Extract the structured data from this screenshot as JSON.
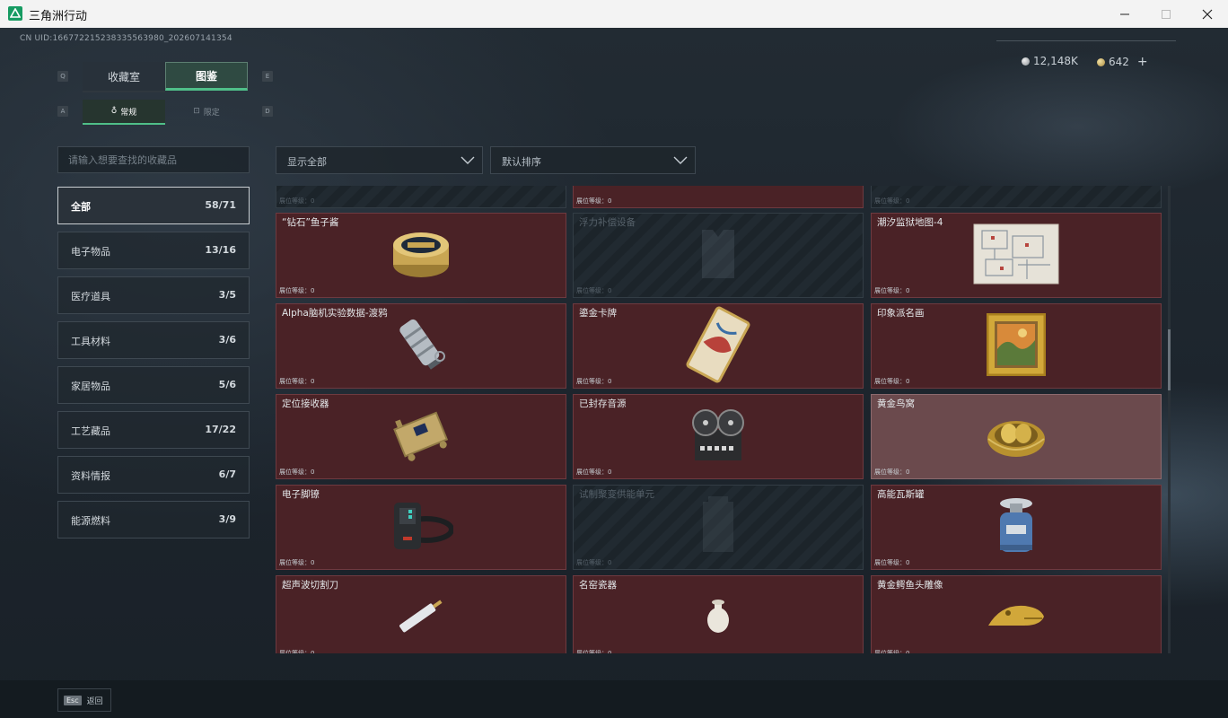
{
  "window": {
    "title": "三角洲行动",
    "min": "—",
    "max": "☐",
    "close": "✕"
  },
  "header": {
    "uid": "CN UID:16677221523833556398​0_202607141354",
    "silver": "12,148K",
    "gold": "642",
    "add": "+"
  },
  "tabs": {
    "collection": "收藏室",
    "dex": "图鉴",
    "key_left": "Q",
    "key_right": "E"
  },
  "subtabs": {
    "normal": "常规",
    "limited": "限定",
    "key_left": "A",
    "key_right": "D"
  },
  "search": {
    "placeholder": "请输入想要查找的收藏品"
  },
  "filters": {
    "show": "显示全部",
    "sort": "默认排序"
  },
  "categories": [
    {
      "name": "全部",
      "count": "58/71"
    },
    {
      "name": "电子物品",
      "count": "13/16"
    },
    {
      "name": "医疗道具",
      "count": "3/5"
    },
    {
      "name": "工具材料",
      "count": "3/6"
    },
    {
      "name": "家居物品",
      "count": "5/6"
    },
    {
      "name": "工艺藏品",
      "count": "17/22"
    },
    {
      "name": "资料情报",
      "count": "6/7"
    },
    {
      "name": "能源燃料",
      "count": "3/9"
    }
  ],
  "level_label": "展位等级：0",
  "items": [
    {
      "name": "",
      "state": "locked",
      "icon": "trophy-icon"
    },
    {
      "name": "",
      "state": "owned",
      "icon": "chessboard-icon"
    },
    {
      "name": "",
      "state": "locked",
      "icon": "robot-icon"
    },
    {
      "name": "“钻石”鱼子酱",
      "state": "owned",
      "icon": "caviar-tin-icon"
    },
    {
      "name": "浮力补偿设备",
      "state": "locked",
      "icon": "diving-vest-icon"
    },
    {
      "name": "潮汐监狱地图-4",
      "state": "owned",
      "icon": "map-icon"
    },
    {
      "name": "Alpha脑机实验数据-渡鸦",
      "state": "owned",
      "icon": "data-drive-icon"
    },
    {
      "name": "鎏金卡牌",
      "state": "owned",
      "icon": "gold-card-icon"
    },
    {
      "name": "印象派名画",
      "state": "owned",
      "icon": "framed-painting-icon"
    },
    {
      "name": "定位接收器",
      "state": "owned",
      "icon": "receiver-icon"
    },
    {
      "name": "已封存音源",
      "state": "owned",
      "icon": "reel-recorder-icon"
    },
    {
      "name": "黄金鸟窝",
      "state": "highlight",
      "icon": "golden-nest-icon"
    },
    {
      "name": "电子脚镣",
      "state": "owned",
      "icon": "ankle-monitor-icon"
    },
    {
      "name": "试制聚变供能单元",
      "state": "locked",
      "icon": "fusion-cell-icon"
    },
    {
      "name": "高能瓦斯罐",
      "state": "owned",
      "icon": "gas-canister-icon"
    },
    {
      "name": "超声波切割刀",
      "state": "owned",
      "icon": "ultrasonic-cutter-icon"
    },
    {
      "name": "名窑瓷器",
      "state": "owned",
      "icon": "porcelain-icon"
    },
    {
      "name": "黄金鳄鱼头雕像",
      "state": "owned",
      "icon": "gold-crocodile-icon"
    }
  ],
  "footer": {
    "esc_key": "Esc",
    "back": "返回"
  },
  "colors": {
    "accent": "#50c08a",
    "card_owned": "#4a2226",
    "card_highlight": "#6b4a4d"
  }
}
